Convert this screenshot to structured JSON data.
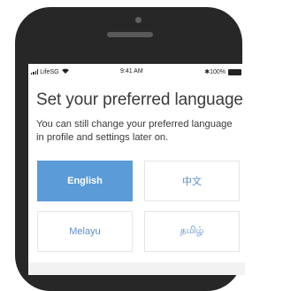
{
  "status_bar": {
    "carrier": "LifeSG",
    "time": "9:41 AM",
    "battery": "100%"
  },
  "title": "Set your preferred language",
  "subtitle": "You can still change your preferred language in profile and settings later on.",
  "languages": [
    {
      "label": "English",
      "selected": true
    },
    {
      "label": "中文",
      "selected": false
    },
    {
      "label": "Melayu",
      "selected": false
    },
    {
      "label": "தமிழ்",
      "selected": false
    }
  ],
  "colors": {
    "accent": "#5b9bd8",
    "text": "#3a3a3a",
    "phone_frame": "#272727"
  },
  "icons": [
    "signal-icon",
    "wifi-icon",
    "bluetooth-icon",
    "battery-icon"
  ]
}
